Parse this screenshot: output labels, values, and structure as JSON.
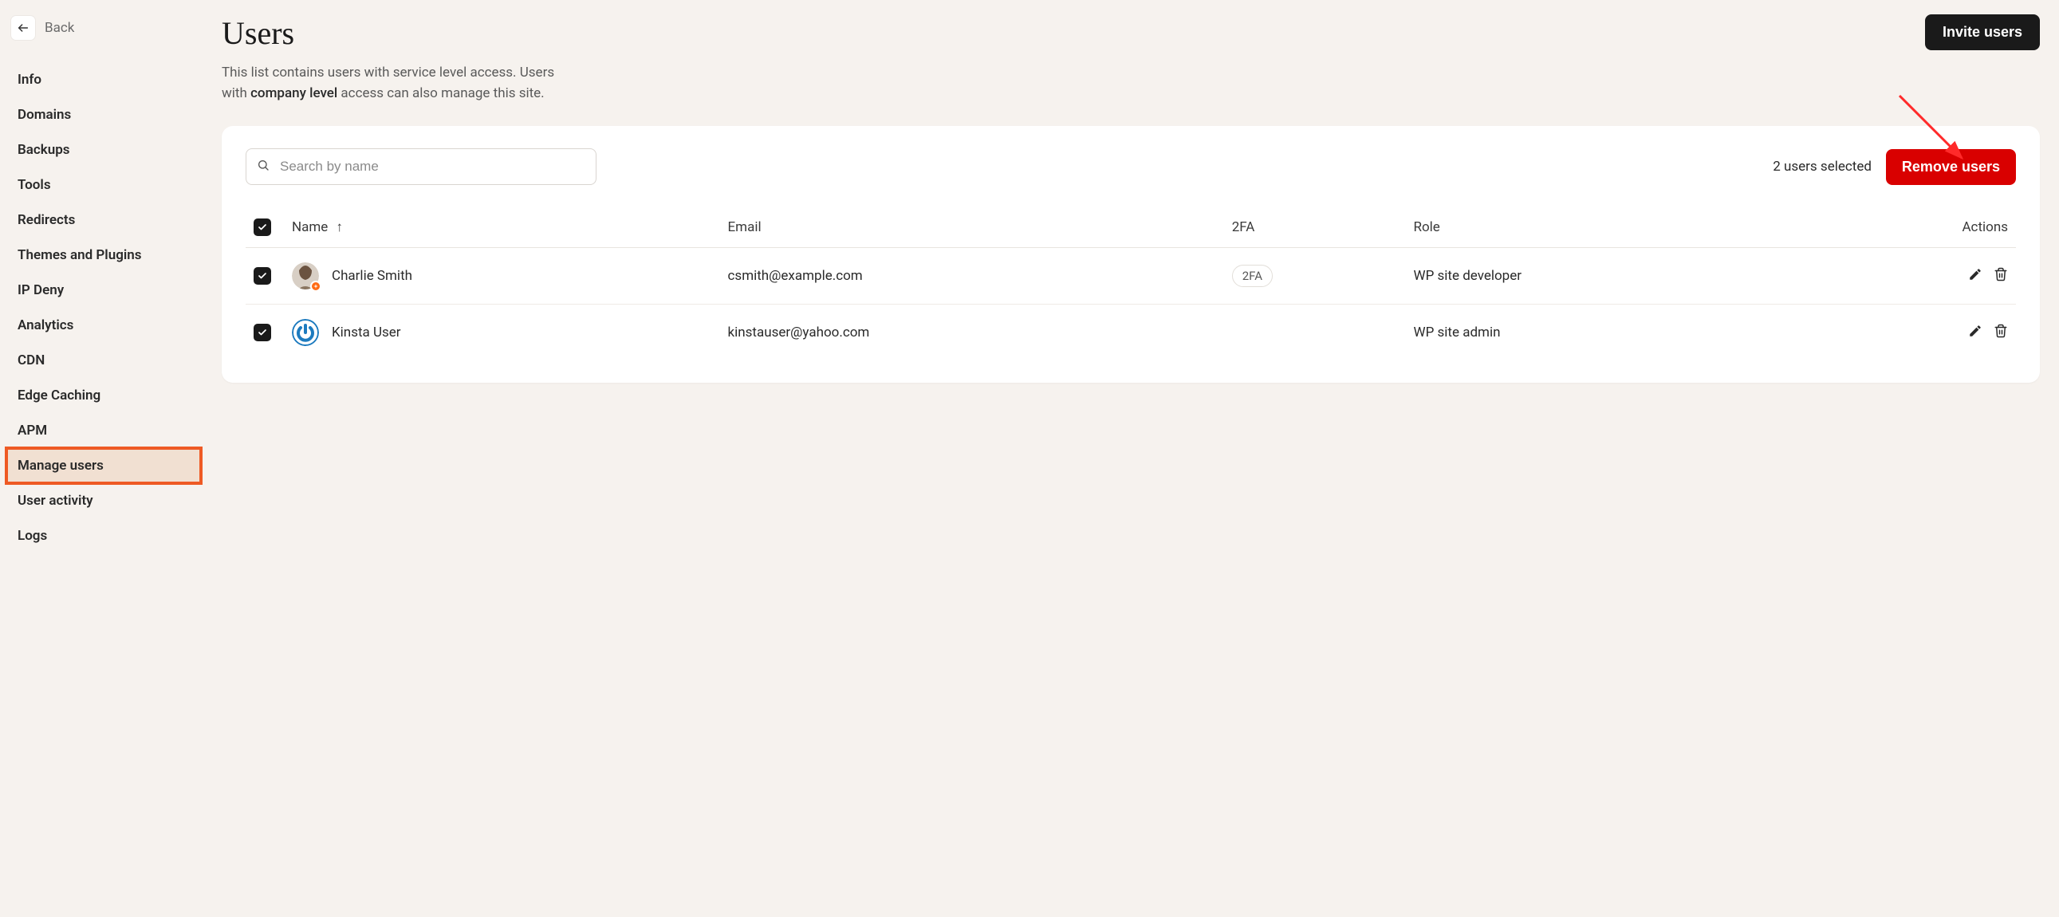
{
  "back_label": "Back",
  "sidebar": {
    "items": [
      {
        "label": "Info"
      },
      {
        "label": "Domains"
      },
      {
        "label": "Backups"
      },
      {
        "label": "Tools"
      },
      {
        "label": "Redirects"
      },
      {
        "label": "Themes and Plugins"
      },
      {
        "label": "IP Deny"
      },
      {
        "label": "Analytics"
      },
      {
        "label": "CDN"
      },
      {
        "label": "Edge Caching"
      },
      {
        "label": "APM"
      },
      {
        "label": "Manage users"
      },
      {
        "label": "User activity"
      },
      {
        "label": "Logs"
      }
    ],
    "active_index": 11
  },
  "page": {
    "title": "Users",
    "desc_prefix": "This list contains users with service level access. Users with ",
    "desc_link": "company level",
    "desc_suffix": " access can also manage this site.",
    "invite_label": "Invite users"
  },
  "toolbar": {
    "search_placeholder": "Search by name",
    "selected_text": "2 users selected",
    "remove_label": "Remove users"
  },
  "table": {
    "headers": {
      "name": "Name",
      "email": "Email",
      "twofa": "2FA",
      "role": "Role",
      "actions": "Actions"
    },
    "rows": [
      {
        "checked": true,
        "name": "Charlie Smith",
        "email": "csmith@example.com",
        "twofa": "2FA",
        "role": "WP site developer",
        "avatar_type": "photo",
        "avatar_badge": true
      },
      {
        "checked": true,
        "name": "Kinsta User",
        "email": "kinstauser@yahoo.com",
        "twofa": "",
        "role": "WP site admin",
        "avatar_type": "gravatar",
        "avatar_badge": false
      }
    ]
  }
}
